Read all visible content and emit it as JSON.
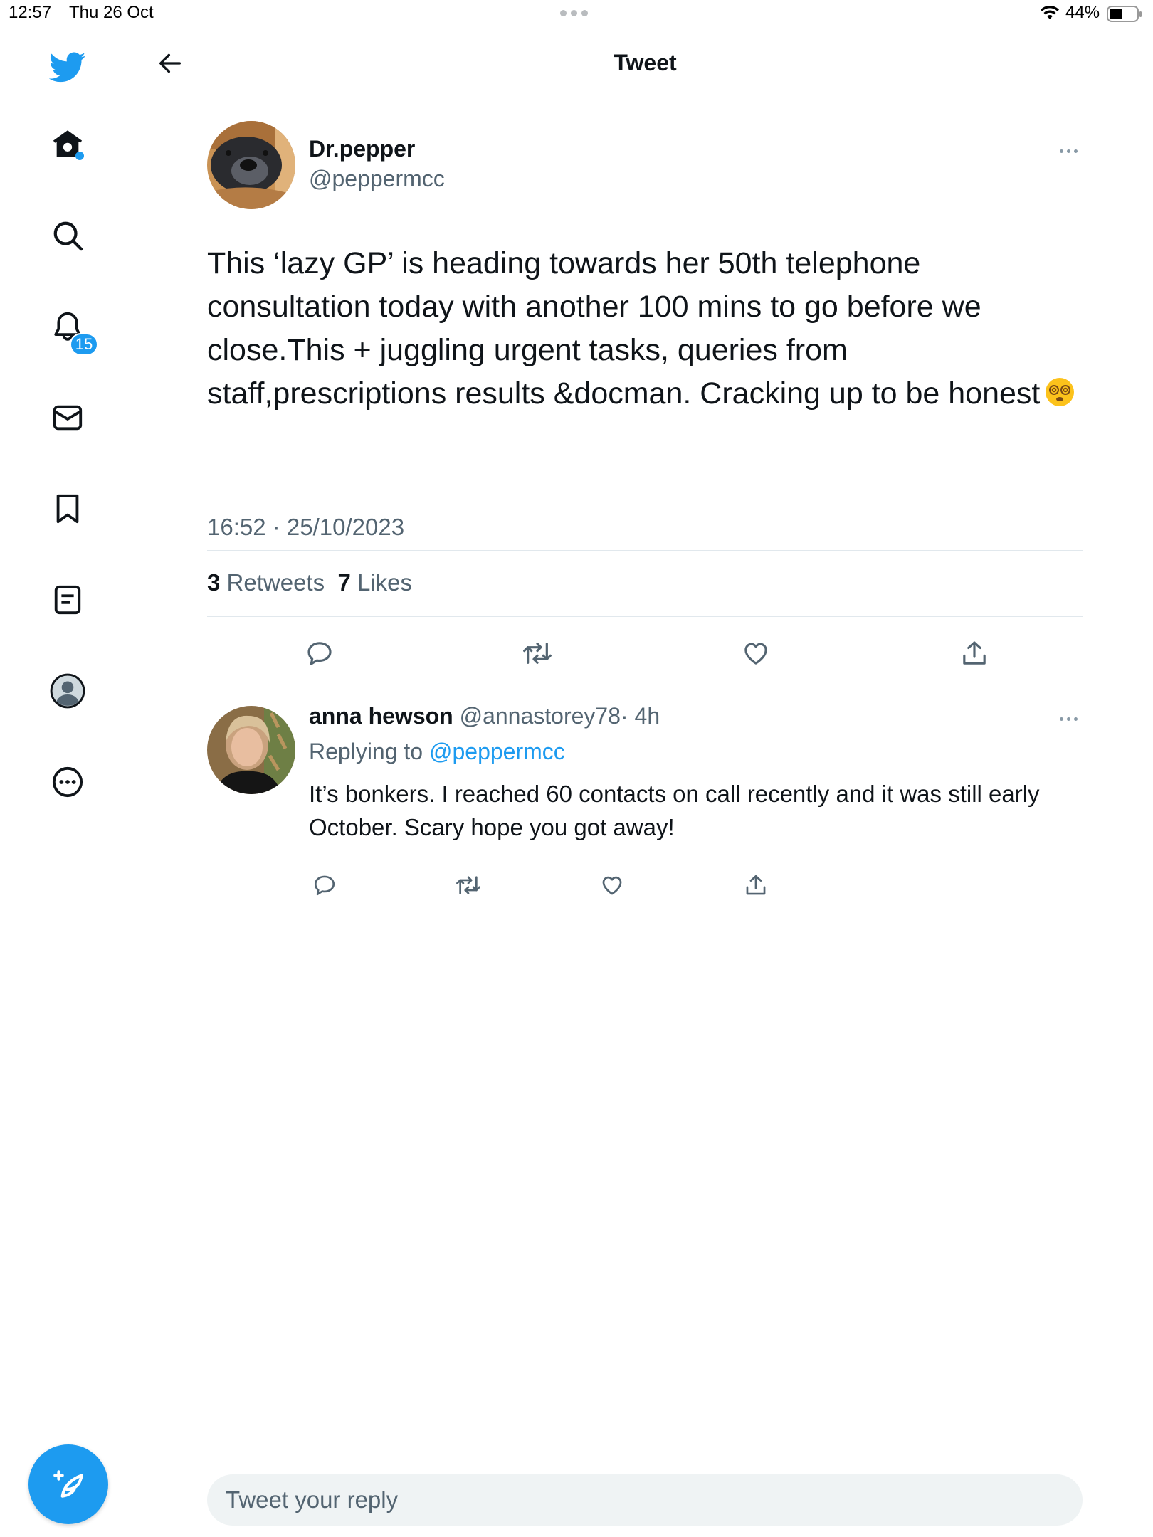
{
  "status_bar": {
    "time": "12:57",
    "date": "Thu 26 Oct",
    "battery": "44%"
  },
  "sidebar": {
    "items": [
      {
        "name": "twitter-logo-icon"
      },
      {
        "name": "home-icon"
      },
      {
        "name": "search-icon"
      },
      {
        "name": "notifications-icon"
      },
      {
        "name": "messages-icon"
      },
      {
        "name": "bookmarks-icon"
      },
      {
        "name": "lists-icon"
      },
      {
        "name": "profile-icon"
      },
      {
        "name": "more-icon"
      }
    ],
    "notification_count": "15",
    "compose_icon": "feather-plus-icon"
  },
  "header": {
    "title": "Tweet"
  },
  "tweet": {
    "author_name": "Dr.pepper",
    "author_handle": "@peppermcc",
    "text": "This ‘lazy GP’ is heading towards her 50th telephone consultation today with another 100 mins to go before we close.This + juggling urgent tasks, queries from staff,prescriptions results &docman. Cracking up to be honest",
    "emoji": "dizzy-face",
    "timestamp": "16:52 · 25/10/2023",
    "retweets_count": "3",
    "retweets_label": "Retweets",
    "likes_count": "7",
    "likes_label": "Likes"
  },
  "reply": {
    "author_name": "anna hewson",
    "author_handle": "@annastorey78",
    "age": "· 4h",
    "replying_prefix": "Replying to",
    "replying_to": "@peppermcc",
    "text": "It’s bonkers. I reached 60 contacts on call recently and it was still early October. Scary hope you got away!"
  },
  "composer": {
    "placeholder": "Tweet your reply"
  },
  "colors": {
    "accent": "#1d9bf0",
    "secondary_text": "#536471",
    "primary_text": "#0f1419",
    "divider": "#e1e8ed"
  }
}
